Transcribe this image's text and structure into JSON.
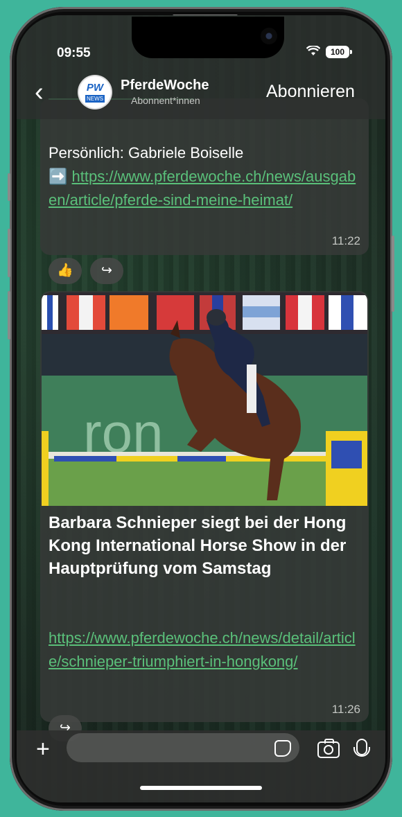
{
  "status": {
    "time": "09:55",
    "battery": "100"
  },
  "header": {
    "back_icon": "‹",
    "avatar_top": "PW",
    "avatar_bottom": "NEWS",
    "title": "PferdeWoche",
    "subtitle": "Abonnent*innen",
    "subscribe": "Abonnieren"
  },
  "messages": [
    {
      "text": "Persönlich: Gabriele Boiselle",
      "arrow_icon": "➡️",
      "link": "https://www.pferdewoche.ch/news/ausgaben/article/pferde-sind-meine-heimat/",
      "time": "11:22",
      "reactions": [
        "👍",
        "↪"
      ]
    },
    {
      "headline": "Barbara Schnieper siegt bei der Hong Kong International Horse Show in der Hauptprüfung vom Samstag",
      "link": "https://www.pferdewoche.ch/news/detail/article/schnieper-triumphiert-in-hongkong/",
      "time": "11:26",
      "reaction": "↪"
    }
  ],
  "colors": {
    "link": "#5ac07a",
    "bubble": "#373a38",
    "background": "#3fb59b"
  }
}
